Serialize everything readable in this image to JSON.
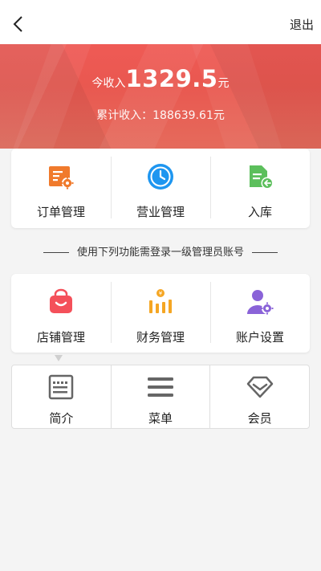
{
  "header": {
    "back_icon": "chevron-left-icon",
    "logout_label": "退出"
  },
  "income": {
    "today_label": "今收入",
    "today_amount": "1329.5",
    "today_unit": "元",
    "total_text": "累计收入：188639.61元"
  },
  "main_menu": [
    {
      "label": "订单管理",
      "icon": "order-settings-icon",
      "color": "#f07a2c"
    },
    {
      "label": "营业管理",
      "icon": "clock-icon",
      "color": "#1e96f0"
    },
    {
      "label": "入库",
      "icon": "document-return-icon",
      "color": "#5cbf5c"
    }
  ],
  "notice": "使用下列功能需登录一级管理员账号",
  "admin_menu": [
    {
      "label": "店铺管理",
      "icon": "shop-bag-icon",
      "color": "#f4505a"
    },
    {
      "label": "财务管理",
      "icon": "finance-bars-icon",
      "color": "#f5a623"
    },
    {
      "label": "账户设置",
      "icon": "user-settings-icon",
      "color": "#8a63d8"
    }
  ],
  "extra_menu": [
    {
      "label": "简介",
      "icon": "intro-document-icon",
      "color": "#666666"
    },
    {
      "label": "菜单",
      "icon": "menu-lines-icon",
      "color": "#666666"
    },
    {
      "label": "会员",
      "icon": "diamond-icon",
      "color": "#666666"
    }
  ]
}
